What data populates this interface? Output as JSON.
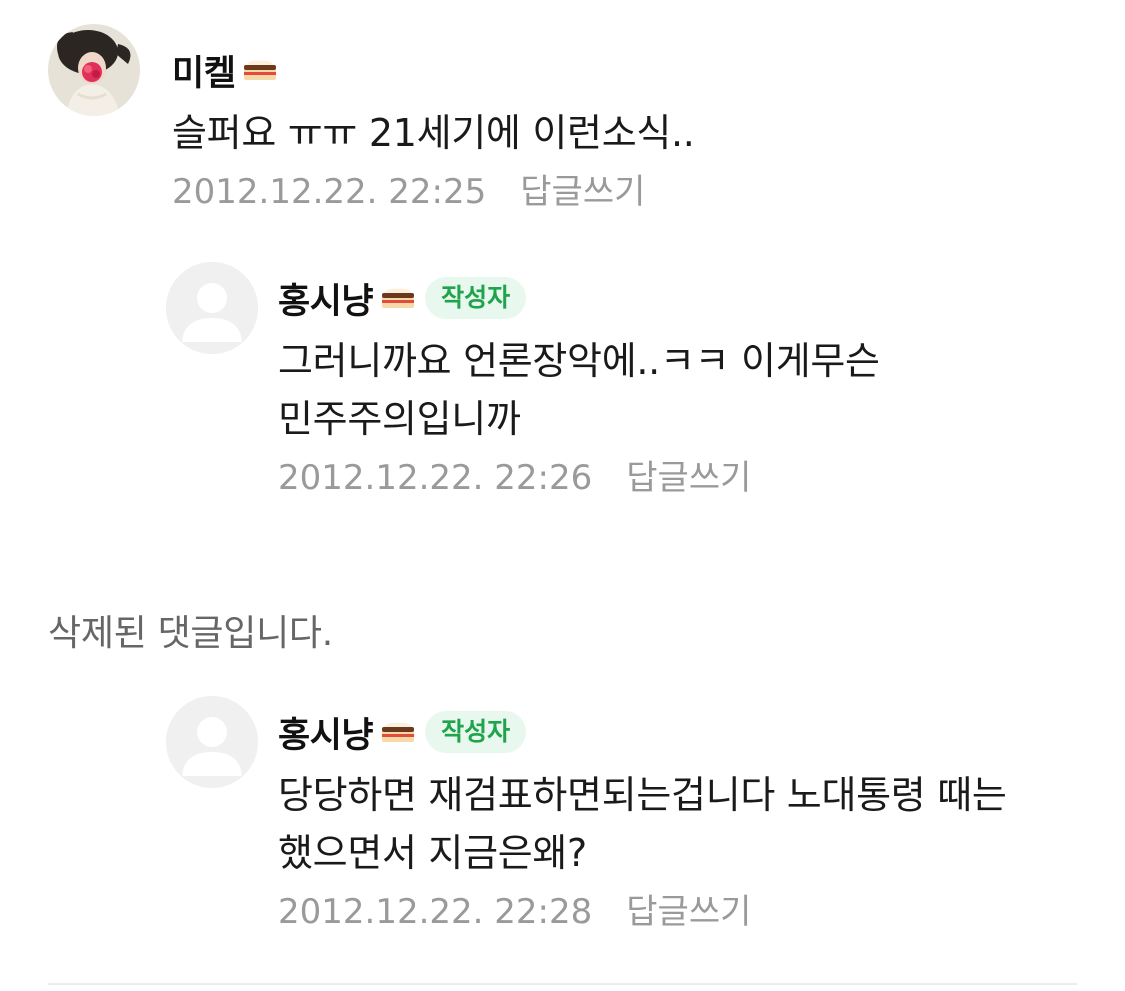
{
  "comments": [
    {
      "nickname": "미켈",
      "text": "슬퍼요 ㅠㅠ 21세기에 이런소식..",
      "timestamp": "2012.12.22. 22:25",
      "reply_label": "답글쓰기",
      "avatar": "user-photo",
      "level_icon": "cake-level-icon"
    },
    {
      "nickname": "홍시냥",
      "badge": "작성자",
      "text": "그러니까요 언론장악에..ㅋㅋ 이게무슨 민주주의입니까",
      "timestamp": "2012.12.22. 22:26",
      "reply_label": "답글쓰기",
      "avatar": "default-profile",
      "level_icon": "cake-level-icon"
    },
    {
      "deleted_text": "삭제된 댓글입니다."
    },
    {
      "nickname": "홍시냥",
      "badge": "작성자",
      "text": "당당하면 재검표하면되는겁니다 노대통령 때는 했으면서 지금은왜?",
      "timestamp": "2012.12.22. 22:28",
      "reply_label": "답글쓰기",
      "avatar": "default-profile",
      "level_icon": "cake-level-icon"
    }
  ],
  "colors": {
    "badge_bg": "#e8f8ee",
    "badge_text": "#1fa34b",
    "meta_text": "#9a9a9a"
  }
}
